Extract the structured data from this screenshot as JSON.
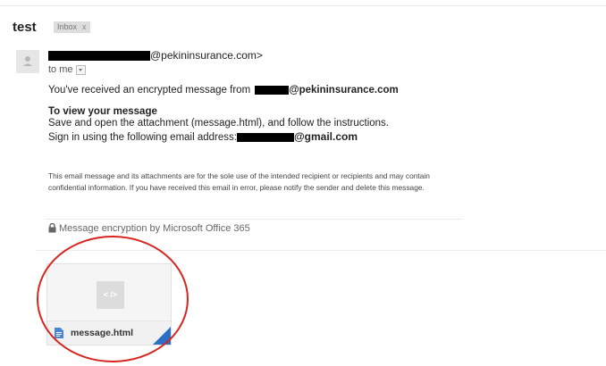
{
  "header": {
    "subject": "test",
    "label": "Inbox",
    "label_remove": "x"
  },
  "message": {
    "avatar_icon": "person-icon",
    "sender_domain": "@pekininsurance.com>",
    "to_label": "to me",
    "line1_prefix": "You've received an encrypted message from",
    "line1_domain": "@pekininsurance.com",
    "view_heading": "To view your message",
    "instructions": "Save and open the attachment (message.html), and follow the instructions.",
    "signin_prefix": "Sign in using the following email address:",
    "signin_domain": "@gmail.com",
    "disclaimer": "This email message and its attachments are for the sole use of the intended recipient or recipients and may contain confidential information. If you have received this email in error, please notify the sender and delete this message.",
    "encryption_footer": "Message encryption by Microsoft Office 365"
  },
  "attachment": {
    "thumb_glyph": "< />",
    "filename": "message.html",
    "file_icon": "document-icon",
    "accent_color": "#2b6fc7"
  },
  "annotation": {
    "shape": "ellipse",
    "color": "#d6261f"
  }
}
